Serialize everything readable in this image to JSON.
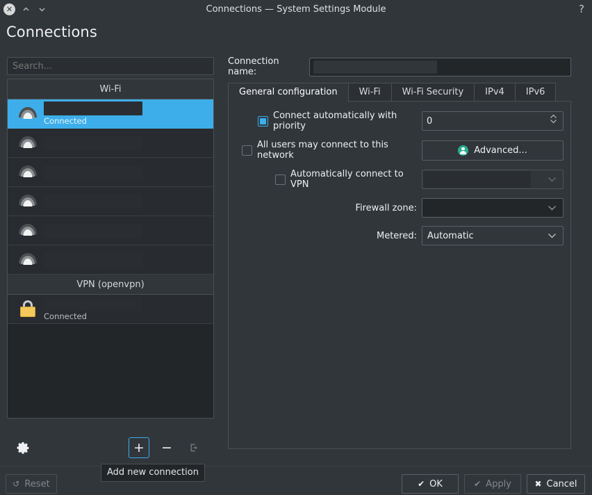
{
  "window": {
    "title": "Connections — System Settings Module",
    "close_icon": "close-circle-icon",
    "chevron_up_icon": "chevron-up-icon",
    "chevron_down_icon": "chevron-down-icon",
    "help_icon": "?"
  },
  "page": {
    "title": "Connections"
  },
  "sidebar": {
    "search_placeholder": "Search...",
    "groups": [
      {
        "header": "Wi-Fi",
        "items": [
          {
            "name": "",
            "status": "Connected",
            "icon": "wifi-icon",
            "selected": true
          },
          {
            "name": "",
            "status": "",
            "icon": "wifi-icon",
            "selected": false
          },
          {
            "name": "",
            "status": "",
            "icon": "wifi-icon",
            "selected": false
          },
          {
            "name": "",
            "status": "",
            "icon": "wifi-icon",
            "selected": false
          },
          {
            "name": "",
            "status": "",
            "icon": "wifi-icon",
            "selected": false
          },
          {
            "name": "",
            "status": "",
            "icon": "wifi-icon",
            "selected": false
          }
        ]
      },
      {
        "header": "VPN (openvpn)",
        "items": [
          {
            "name": "",
            "status": "Connected",
            "icon": "lock-icon",
            "selected": false
          }
        ]
      }
    ],
    "tooltip": "Add new connection",
    "toolbar": {
      "settings_icon": "gear-icon",
      "add_label": "+",
      "remove_label": "−",
      "export_icon": "export-icon"
    }
  },
  "form": {
    "connection_name_label": "Connection name:",
    "connection_name_value": "",
    "tabs": [
      {
        "label": "General configuration",
        "active": true
      },
      {
        "label": "Wi-Fi",
        "active": false
      },
      {
        "label": "Wi-Fi Security",
        "active": false
      },
      {
        "label": "IPv4",
        "active": false
      },
      {
        "label": "IPv6",
        "active": false
      }
    ],
    "connect_auto_label": "Connect automatically with priority",
    "connect_auto_checked": true,
    "priority_value": "0",
    "all_users_label": "All users may connect to this network",
    "all_users_checked": false,
    "advanced_label": "Advanced...",
    "advanced_icon": "user-icon",
    "auto_vpn_label": "Automatically connect to VPN",
    "auto_vpn_checked": false,
    "auto_vpn_value": "",
    "firewall_label": "Firewall zone:",
    "firewall_value": "",
    "metered_label": "Metered:",
    "metered_value": "Automatic"
  },
  "footer": {
    "reset_label": "Reset",
    "reset_icon": "↺",
    "ok_label": "OK",
    "ok_icon": "✔",
    "apply_label": "Apply",
    "apply_icon": "✔",
    "cancel_label": "Cancel",
    "cancel_icon": "✖"
  },
  "colors": {
    "window_bg": "#31363b",
    "list_bg": "#232629",
    "selection": "#3daee9",
    "accent_green": "#27ae90",
    "lock_yellow": "#f3c95b",
    "text": "#eff0f1",
    "disabled_text": "#80878c"
  }
}
